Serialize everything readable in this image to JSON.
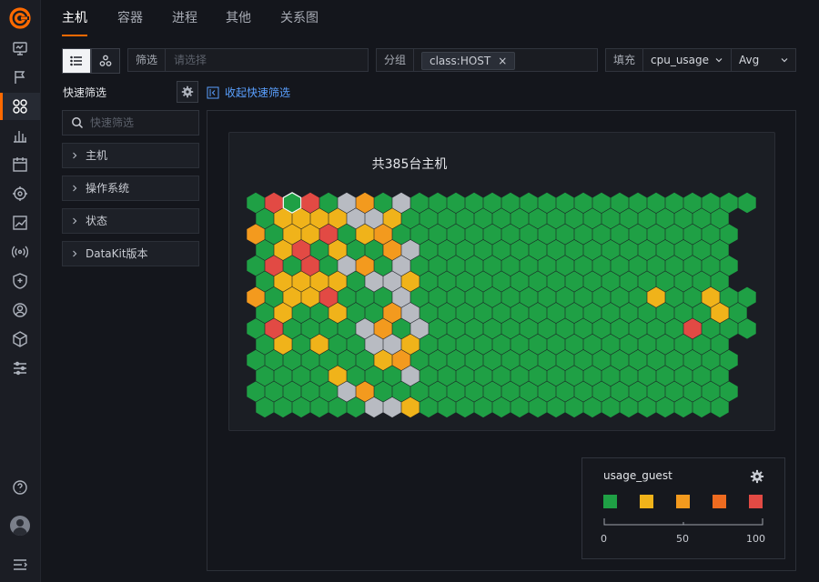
{
  "tabs": [
    {
      "label": "主机",
      "active": true
    },
    {
      "label": "容器",
      "active": false
    },
    {
      "label": "进程",
      "active": false
    },
    {
      "label": "其他",
      "active": false
    },
    {
      "label": "关系图",
      "active": false
    }
  ],
  "rail_icons": [
    "monitor-icon",
    "flag-icon",
    "hosts-icon",
    "bar-chart-icon",
    "calendar-icon",
    "target-icon",
    "line-chart-icon",
    "signal-icon",
    "shield-icon",
    "user-icon",
    "cube-icon",
    "sliders-icon"
  ],
  "toolbar": {
    "filter_label": "筛选",
    "filter_placeholder": "请选择",
    "group_label": "分组",
    "group_tag": "class:HOST",
    "fill_label": "填充",
    "fill_metric": "cpu_usage",
    "fill_agg": "Avg"
  },
  "quick_filter": {
    "title": "快速筛选",
    "collapse_label": "收起快速筛选",
    "search_placeholder": "快速筛选",
    "facets": [
      "主机",
      "操作系统",
      "状态",
      "DataKit版本"
    ]
  },
  "map": {
    "title": "共385台主机",
    "colors": {
      "G": "#1fa045",
      "Y": "#f0b31a",
      "O": "#f39a1e",
      "D": "#ee6b20",
      "R": "#e24a44",
      "S": "#b8bbc2"
    },
    "rows": [
      "GRGRGSOGSGGGGGGGGGGGGGGGGGGG",
      "GYYYYSSYGGGGGGGGGGGGGGGGGG",
      "OGYYRGYOGGGGGGGGGGGGGGGGGGG",
      "GYRGYGGOSGGGGGGGGGGGGGGGGG",
      "GRGRGSOGSGGGGGGGGGGGGGGGGGG",
      "GYYYYGSSYGGGGGGGGGGGGGGGGG",
      "OGYYRGGGSGGGGGGGGGGGGGYGGYGGG",
      "GYGGYGGOSGGGGGGGGGGGGGGGGYGG",
      "GRGGGGSOGSGGGGGGGGGGGGGGRGGG",
      "GYGYGGSSYGGGGGGGGGGGGGGGGG",
      "GGGGGGGYOGGGGGGGGGGGGGGGGGG",
      "GGGGYGGGSGGGGGGGGGGGGGGGGG",
      "GGGGGSOGGGGGGGGGGGGGGGGGGGG",
      "GGGGGGSSYGGGGGGGGGGGGGGGGG"
    ],
    "selected_index": 2
  },
  "legend": {
    "title": "usage_guest",
    "swatches": [
      "#1fa045",
      "#f0b31a",
      "#f39a1e",
      "#ee6b20",
      "#e24a44"
    ],
    "ticks": [
      "0",
      "50",
      "100"
    ]
  }
}
